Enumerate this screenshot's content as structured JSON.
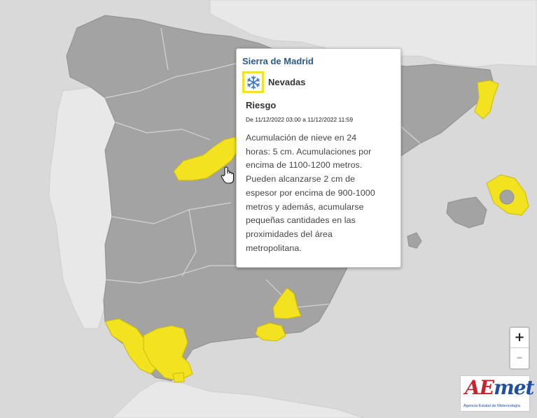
{
  "popup": {
    "title": "Sierra de Madrid",
    "phenomenon": "Nevadas",
    "risk_heading": "Riesgo",
    "period": "De 11/12/2022 03:00 a 11/12/2022 11:59",
    "description_lines": [
      "Acumulación de nieve en 24",
      "horas: 5 cm. Acumulaciones por",
      "encima de 1100-1200 metros.",
      "Pueden alcanzarse 2 cm de",
      "espesor por encima de 900-1000",
      "metros y además, acumularse",
      "pequeñas cantidades en las",
      "proximidades del área",
      "metropolitana."
    ],
    "phenomenon_icon": "snowflake-icon",
    "warning_color": "#f2e21f"
  },
  "map": {
    "land_color": "#a3a3a3",
    "sea_color": "#d9d9d9",
    "neighbour_color": "#e6e6e6",
    "warning_fill": "#f2e21f",
    "warning_areas": [
      "Sierra de Madrid",
      "Girona coast",
      "Menorca",
      "Granada interior",
      "Almería",
      "Cádiz coast",
      "Málaga"
    ]
  },
  "zoom": {
    "in_label": "+",
    "out_label": "–"
  },
  "logo": {
    "word_part1": "AE",
    "word_part2": "met",
    "subtitle": "Agencia Estatal de Meteorología"
  }
}
